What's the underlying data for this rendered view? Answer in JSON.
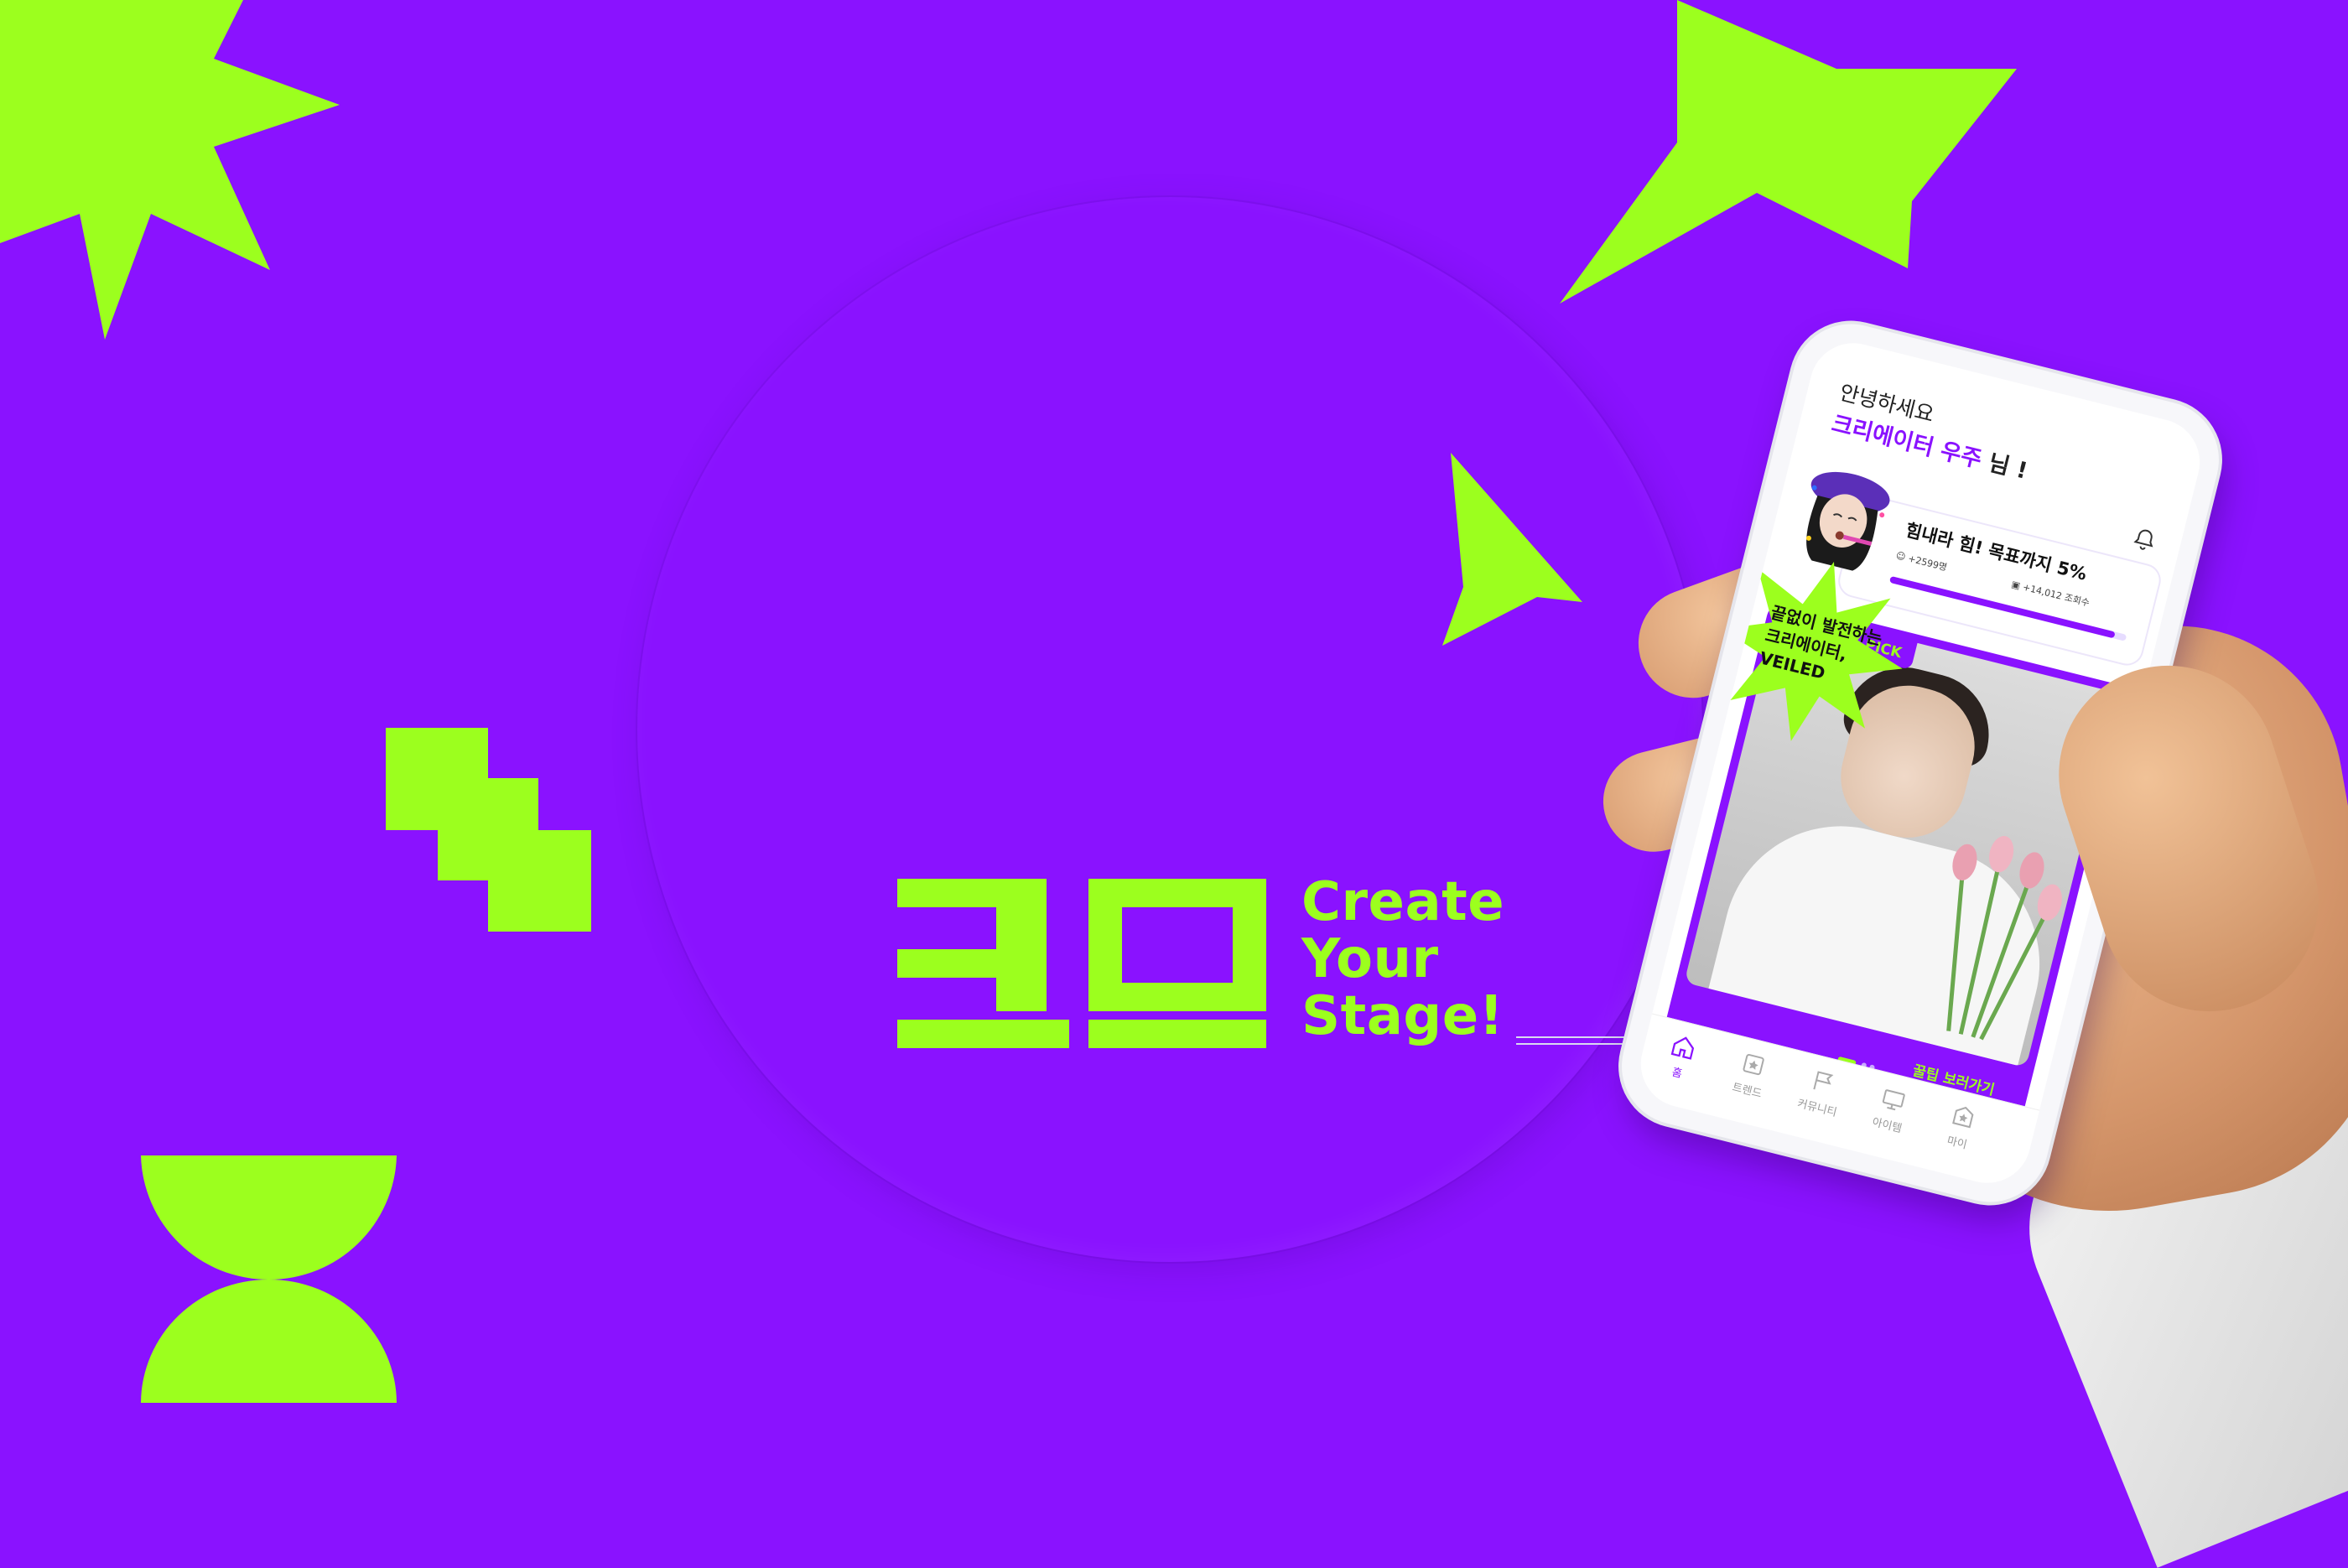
{
  "brand": {
    "tagline": [
      "Create",
      "Your",
      "Stage!"
    ],
    "accent_color": "#9cff1e",
    "background_color": "#8a12ff"
  },
  "app": {
    "greeting_line1": "안녕하세요",
    "greeting_user": "크리에이터 우주",
    "greeting_suffix": " 님 !",
    "goal": {
      "title": "힘내라 힘! 목표까지 5%",
      "stat_subscribers": "+2599명",
      "stat_views": "+14,012 조회수",
      "progress_percent": 95
    },
    "pick": {
      "label": "오늘의 크스 PICK",
      "burst_text_line1": "끝없이 발전하는",
      "burst_text_line2": "크리에이터,",
      "burst_text_line3": "VEILED",
      "more_link": "꿀팁 보러가기",
      "carousel_pages": 3,
      "carousel_active": 1
    },
    "tabs": [
      {
        "label": "홈",
        "icon": "home-icon",
        "active": true
      },
      {
        "label": "트렌드",
        "icon": "trend-icon",
        "active": false
      },
      {
        "label": "커뮤니티",
        "icon": "community-icon",
        "active": false
      },
      {
        "label": "아이템",
        "icon": "item-icon",
        "active": false
      },
      {
        "label": "마이",
        "icon": "my-icon",
        "active": false
      }
    ]
  }
}
